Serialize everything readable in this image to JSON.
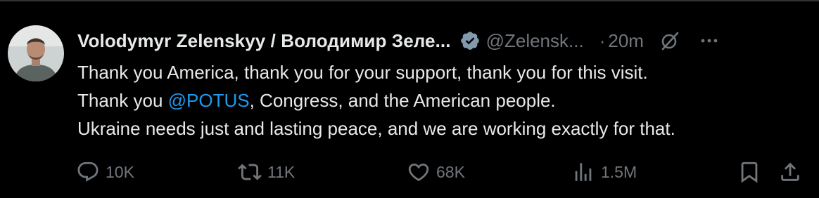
{
  "tweet": {
    "author_name": "Volodymyr Zelenskyy / Володимир Зеле...",
    "handle": "@Zelensk...",
    "separator": "·",
    "time": "20m",
    "text_line1": "Thank you America, thank you for your support, thank you for this visit.",
    "text_line2_prefix": "Thank you ",
    "mention": "@POTUS",
    "text_line2_suffix": ", Congress, and the American people.",
    "text_line3": "Ukraine needs just and lasting peace, and we are working exactly for that."
  },
  "actions": {
    "replies": "10K",
    "reposts": "11K",
    "likes": "68K",
    "views": "1.5M"
  },
  "icons": {
    "verified": "verified-badge-icon",
    "grok": "grok-icon",
    "more": "more-icon",
    "reply": "reply-icon",
    "repost": "repost-icon",
    "like": "like-icon",
    "views": "views-icon",
    "bookmark": "bookmark-icon",
    "share": "share-icon"
  },
  "colors": {
    "background": "#000000",
    "text": "#e7e9ea",
    "secondary": "#71767b",
    "link": "#1d9bf0",
    "verified": "#829aab"
  }
}
